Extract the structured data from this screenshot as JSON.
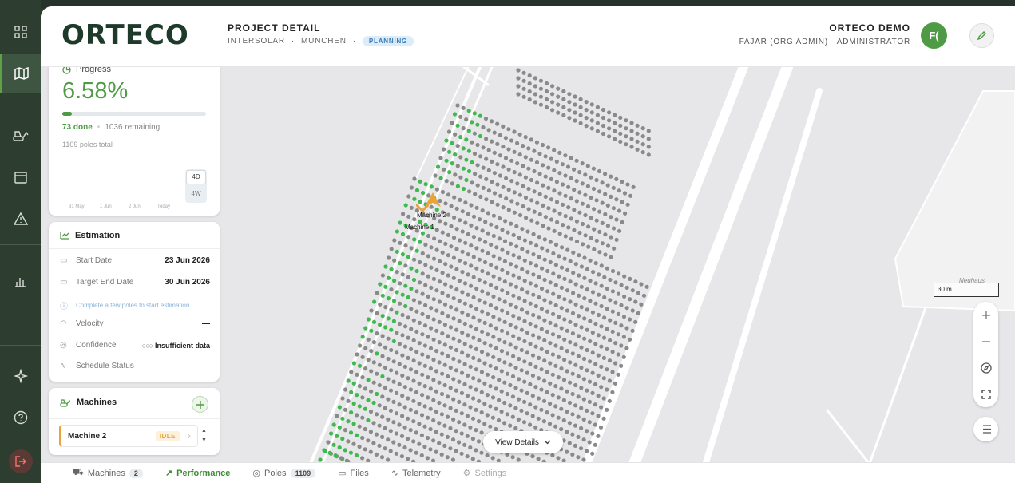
{
  "nav": {
    "items": [
      {
        "name": "grid-icon"
      },
      {
        "name": "map-icon"
      },
      {
        "name": "excavator-icon"
      },
      {
        "name": "calendar-icon"
      },
      {
        "name": "warning-icon"
      },
      {
        "name": "bar-chart-icon"
      },
      {
        "name": "sparkle-icon"
      },
      {
        "name": "help-icon"
      },
      {
        "name": "logout-icon"
      }
    ]
  },
  "header": {
    "logo_text": "ORTECO",
    "title": "PROJECT DETAIL",
    "project": "INTERSOLAR",
    "location": "MUNCHEN",
    "status": "PLANNING",
    "org": "ORTECO DEMO",
    "user": "FAJAR (ORG ADMIN)",
    "role": "ADMINISTRATOR",
    "avatar": "F("
  },
  "progress": {
    "title": "Progress",
    "percent": "6.58%",
    "fraction": 0.0658,
    "done": "73 done",
    "remaining": "1036 remaining",
    "total": "1109 poles total",
    "range_4d": "4D",
    "range_4w": "4W",
    "chart_ticks": [
      "31 May",
      "1 Jun",
      "2 Jun",
      "Today"
    ]
  },
  "estimation": {
    "title": "Estimation",
    "rows": [
      {
        "label": "Start Date",
        "value": "23 Jun 2026"
      },
      {
        "label": "Target End Date",
        "value": "30 Jun 2026"
      }
    ],
    "note": "Complete a few poles to start estimation.",
    "velocity_label": "Velocity",
    "velocity_value": "—",
    "confidence_label": "Confidence",
    "confidence_value": "Insufficient data",
    "schedule_label": "Schedule Status",
    "schedule_value": "—"
  },
  "machines": {
    "title": "Machines",
    "item_name": "Machine 2",
    "item_status": "IDLE"
  },
  "map": {
    "marker1": "Machine 1",
    "marker2": "Machine 2",
    "scale": "30 m",
    "place": "Neuhaus",
    "view_details": "View Details",
    "done_color": "#3fb950",
    "pending_color": "#8a8a8a"
  },
  "bottom_tabs": [
    {
      "label": "Machines",
      "count": "2"
    },
    {
      "label": "Performance",
      "count": ""
    },
    {
      "label": "Poles",
      "count": "1109"
    },
    {
      "label": "Files",
      "count": ""
    },
    {
      "label": "Telemetry",
      "count": ""
    },
    {
      "label": "Settings",
      "count": ""
    }
  ],
  "colors": {
    "accent": "#4f9b45",
    "brand_dark": "#1e3a2a",
    "warning": "#e8a33a"
  }
}
